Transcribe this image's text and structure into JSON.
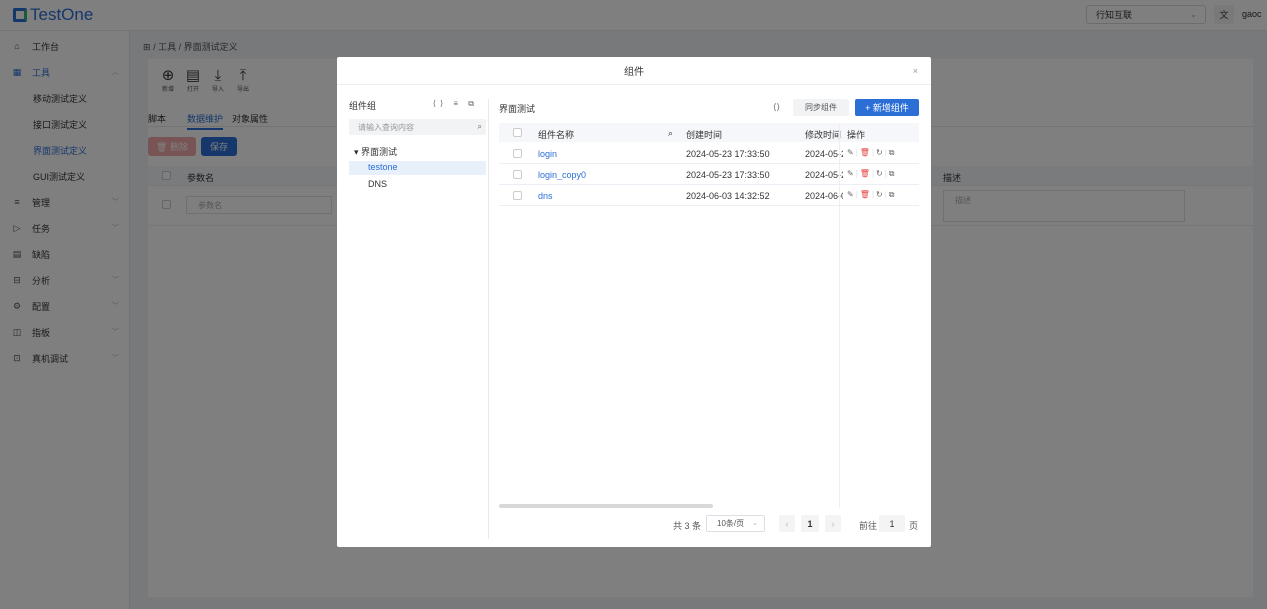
{
  "app": {
    "logo": "TestOne",
    "tenant": "行知互联",
    "lang_icon": "translate-icon",
    "lang_glyph": "文",
    "user": "gaoc"
  },
  "sidebar": {
    "items": [
      {
        "label": "工作台",
        "icon": "home-icon",
        "glyph": "⌂"
      },
      {
        "label": "工具",
        "icon": "grid-icon",
        "glyph": "▦",
        "expanded": true
      },
      {
        "label": "移动测试定义"
      },
      {
        "label": "接口测试定义"
      },
      {
        "label": "界面测试定义",
        "selected": true
      },
      {
        "label": "GUI测试定义"
      },
      {
        "label": "管理",
        "icon": "list-icon",
        "glyph": "≡"
      },
      {
        "label": "任务",
        "icon": "play-icon",
        "glyph": "▷"
      },
      {
        "label": "缺陷",
        "icon": "doc-icon",
        "glyph": "▤"
      },
      {
        "label": "分析",
        "icon": "calendar-icon",
        "glyph": "⊟"
      },
      {
        "label": "配置",
        "icon": "gear-icon",
        "glyph": "⚙"
      },
      {
        "label": "指板",
        "icon": "panel-icon",
        "glyph": "◫"
      },
      {
        "label": "真机调试",
        "icon": "device-icon",
        "glyph": "⊡"
      }
    ],
    "collapse_icon": "≡"
  },
  "breadcrumb": {
    "home": "⊞",
    "sep": "/",
    "parts": [
      "工具",
      "界面测试定义"
    ]
  },
  "toolbar": {
    "items": [
      {
        "label": "新增",
        "glyph": "⊕"
      },
      {
        "label": "打开",
        "glyph": "▤"
      },
      {
        "label": "导入",
        "glyph": "⤓"
      },
      {
        "label": "导出",
        "glyph": "⤒"
      }
    ]
  },
  "tabs": [
    "脚本",
    "数据维护",
    "对象属性"
  ],
  "buttons": {
    "delete": "🗑 删除",
    "save": "保存"
  },
  "param_table": {
    "col_name": "参数名",
    "col_desc": "描述",
    "name_placeholder": "参数名",
    "desc_placeholder": "描述"
  },
  "dialog": {
    "title": "组件",
    "close": "×",
    "left": {
      "title": "组件组",
      "icons": "⟨⟩ ≡ ⧉",
      "search_placeholder": "请输入查询内容",
      "search_icon": "⌕",
      "tree": {
        "root": "界面测试",
        "caret": "▾",
        "children": [
          "testone",
          "DNS"
        ]
      }
    },
    "right": {
      "title": "界面测试",
      "refresh_icon": "⟨⟩",
      "sync": "同步组件",
      "add": "+ 新增组件",
      "columns": {
        "name": "组件名称",
        "search": "⌕",
        "created": "创建时间",
        "modified": "修改时间",
        "ops": "操作"
      },
      "rows": [
        {
          "name": "login",
          "created": "2024-05-23 17:33:50",
          "modified": "2024-05-2"
        },
        {
          "name": "login_copy0",
          "created": "2024-05-23 17:33:50",
          "modified": "2024-05-2"
        },
        {
          "name": "dns",
          "created": "2024-06-03 14:32:52",
          "modified": "2024-06-0"
        }
      ],
      "ops_glyphs": {
        "edit": "✎",
        "delete": "🗑",
        "refresh": "↻",
        "copy": "⧉"
      },
      "pager": {
        "total": "共 3 条",
        "size": "10条/页",
        "size_chev": "⌄",
        "prev": "‹",
        "page": "1",
        "next": "›",
        "goto": "前往",
        "goto_val": "1",
        "page_unit": "页"
      }
    }
  }
}
